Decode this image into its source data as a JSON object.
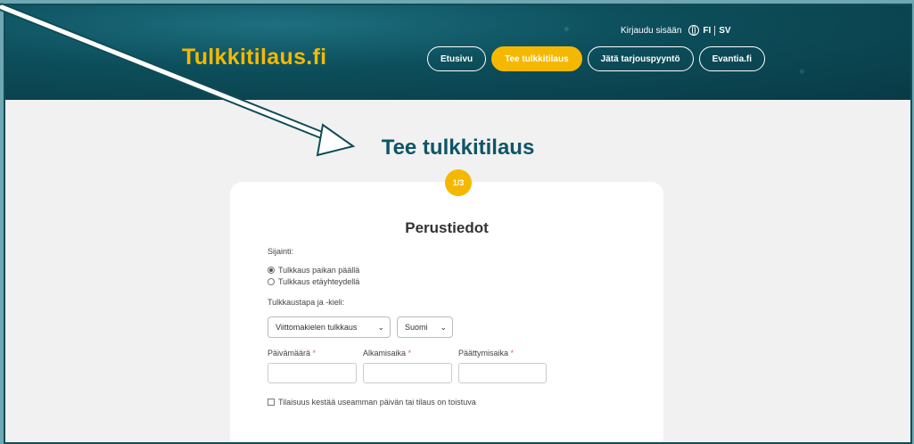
{
  "header": {
    "logo": "Tulkkitilaus.fi",
    "login": "Kirjaudu sisään",
    "lang_fi": "FI",
    "lang_sv": "SV",
    "nav": [
      "Etusivu",
      "Tee tulkkitilaus",
      "Jätä tarjouspyyntö",
      "Evantia.fi"
    ],
    "active_nav": "Tee tulkkitilaus"
  },
  "page": {
    "title": "Tee tulkkitilaus",
    "step": "1/3",
    "section_title": "Perustiedot"
  },
  "form": {
    "location_label": "Sijainti:",
    "location_options": [
      "Tulkkaus paikan päällä",
      "Tulkkaus etäyhteydellä"
    ],
    "location_selected": "Tulkkaus paikan päällä",
    "method_label": "Tulkkaustapa ja -kieli:",
    "method_value": "Viittomakielen tulkkaus",
    "language_value": "Suomi",
    "date_label": "Päivämäärä",
    "start_label": "Alkamisaika",
    "end_label": "Päättymisaika",
    "required_mark": "*",
    "recurring_label": "Tilaisuus kestää useamman päivän tai tilaus on toistuva"
  },
  "colors": {
    "accent": "#f5b800",
    "header_bg": "#0d4f5c",
    "title": "#0e5566",
    "frame": "#6fa8b3"
  }
}
